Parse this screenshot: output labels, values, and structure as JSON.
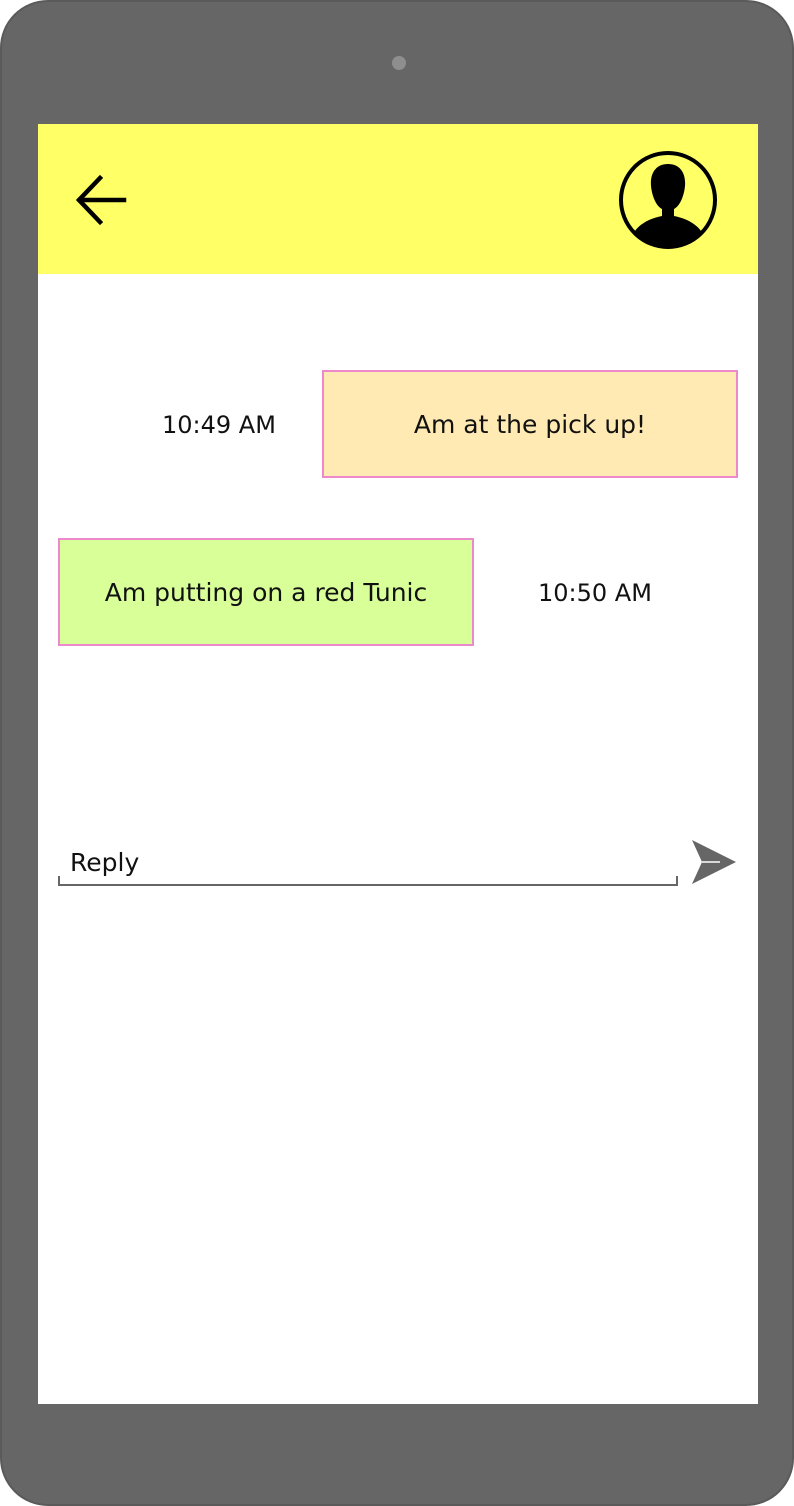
{
  "messages": [
    {
      "direction": "outgoing",
      "text": "Am at the pick up!",
      "time": "10:49 AM"
    },
    {
      "direction": "incoming",
      "text": "Am putting on a red Tunic",
      "time": "10:50 AM"
    }
  ],
  "reply": {
    "placeholder": "Reply",
    "value": ""
  },
  "icons": {
    "back": "arrow-left-icon",
    "avatar": "user-avatar-icon",
    "send": "send-icon"
  },
  "colors": {
    "device_frame": "#666666",
    "header": "#ffff66",
    "outgoing_bubble": "#ffeab3",
    "incoming_bubble": "#d9ff99",
    "bubble_border": "#ee88cc"
  }
}
